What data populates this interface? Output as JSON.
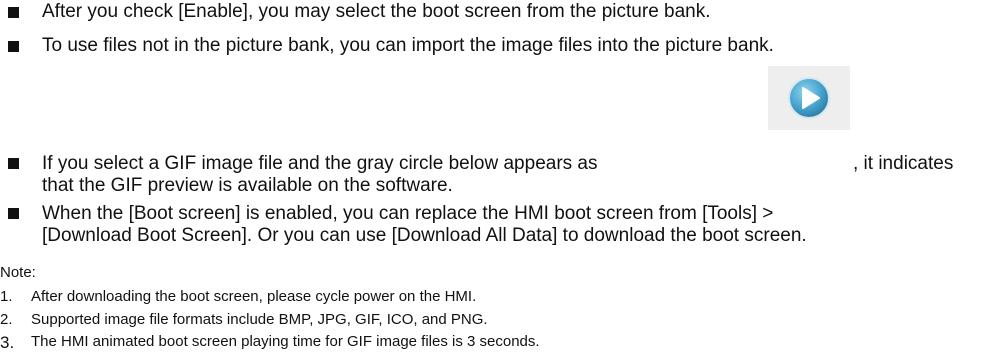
{
  "bullets": [
    {
      "lines": [
        "After you check [Enable], you may select the boot screen from the picture bank."
      ]
    },
    {
      "lines": [
        "To use files not in the picture bank, you can import the image files into the picture bank."
      ]
    },
    {
      "lines": [
        "If you select a GIF image file and the gray circle below appears as",
        ", it indicates",
        "that the GIF preview is available on the software."
      ]
    },
    {
      "lines": [
        "When the [Boot screen] is enabled, you can replace the HMI boot screen from [Tools] >",
        "[Download Boot Screen]. Or you can use [Download All Data] to download the boot screen."
      ]
    }
  ],
  "icon": {
    "name": "play-icon",
    "color_outer": "#4aa6cf",
    "color_inner": "#ffffff"
  },
  "note": {
    "label": "Note:",
    "items": [
      {
        "num": "1.",
        "text": "After downloading the boot screen, please cycle power on the HMI."
      },
      {
        "num": "2.",
        "text": "Supported image file formats include BMP, JPG, GIF, ICO, and PNG."
      },
      {
        "num": "3.",
        "text": "The HMI animated boot screen playing time for GIF image files is 3 seconds."
      }
    ]
  }
}
